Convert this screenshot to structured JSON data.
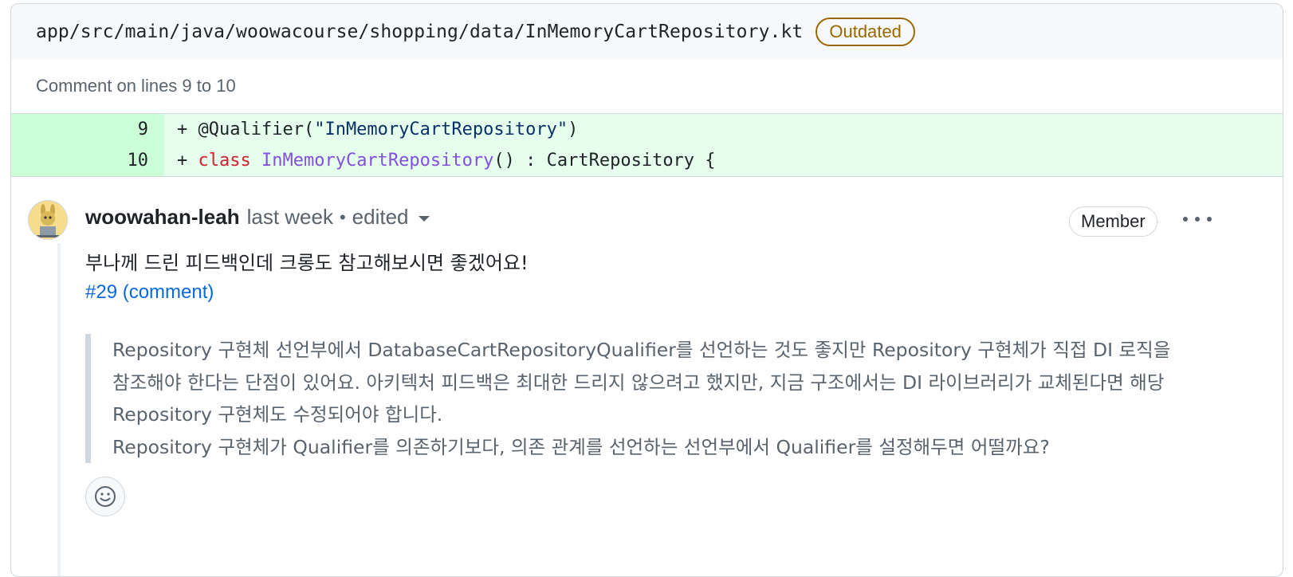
{
  "file": {
    "path": "app/src/main/java/woowacourse/shopping/data/InMemoryCartRepository.kt",
    "badge": "Outdated"
  },
  "comment_range": "Comment on lines 9 to 10",
  "diff": {
    "lines": [
      {
        "number": "9",
        "prefix": "+ ",
        "parts": [
          {
            "kind": "plain",
            "text": "@Qualifier("
          },
          {
            "kind": "str",
            "text": "\"InMemoryCartRepository\""
          },
          {
            "kind": "plain",
            "text": ")"
          }
        ]
      },
      {
        "number": "10",
        "prefix": "+ ",
        "parts": [
          {
            "kind": "kw",
            "text": "class"
          },
          {
            "kind": "plain",
            "text": " "
          },
          {
            "kind": "cls",
            "text": "InMemoryCartRepository"
          },
          {
            "kind": "plain",
            "text": "() : CartRepository {"
          }
        ]
      }
    ]
  },
  "comment": {
    "author": "woowahan-leah",
    "when": "last week",
    "separator": "•",
    "edited": "edited",
    "role_badge": "Member",
    "body": "부나께 드린 피드백인데 크롱도 참고해보시면 좋겠어요!",
    "link": "#29 (comment)",
    "quote": [
      "Repository 구현체 선언부에서 DatabaseCartRepositoryQualifier를 선언하는 것도 좋지만 Repository 구현체가 직접 DI 로직을 참조해야 한다는 단점이 있어요. 아키텍처 피드백은 최대한 드리지 않으려고 했지만, 지금 구조에서는 DI 라이브러리가 교체된다면 해당 Repository 구현체도 수정되어야 합니다.",
      "Repository 구현체가 Qualifier를 의존하기보다, 의존 관계를 선언하는 선언부에서 Qualifier를 설정해두면 어떨까요?"
    ]
  },
  "icons": {
    "more": "kebab-horizontal-icon",
    "reaction": "smiley-icon",
    "edited_menu": "triangle-down-icon"
  },
  "colors": {
    "added_line_bg": "#e6ffec",
    "added_num_bg": "#ccffd8",
    "outdated": "#9a6700",
    "link": "#0969da"
  }
}
